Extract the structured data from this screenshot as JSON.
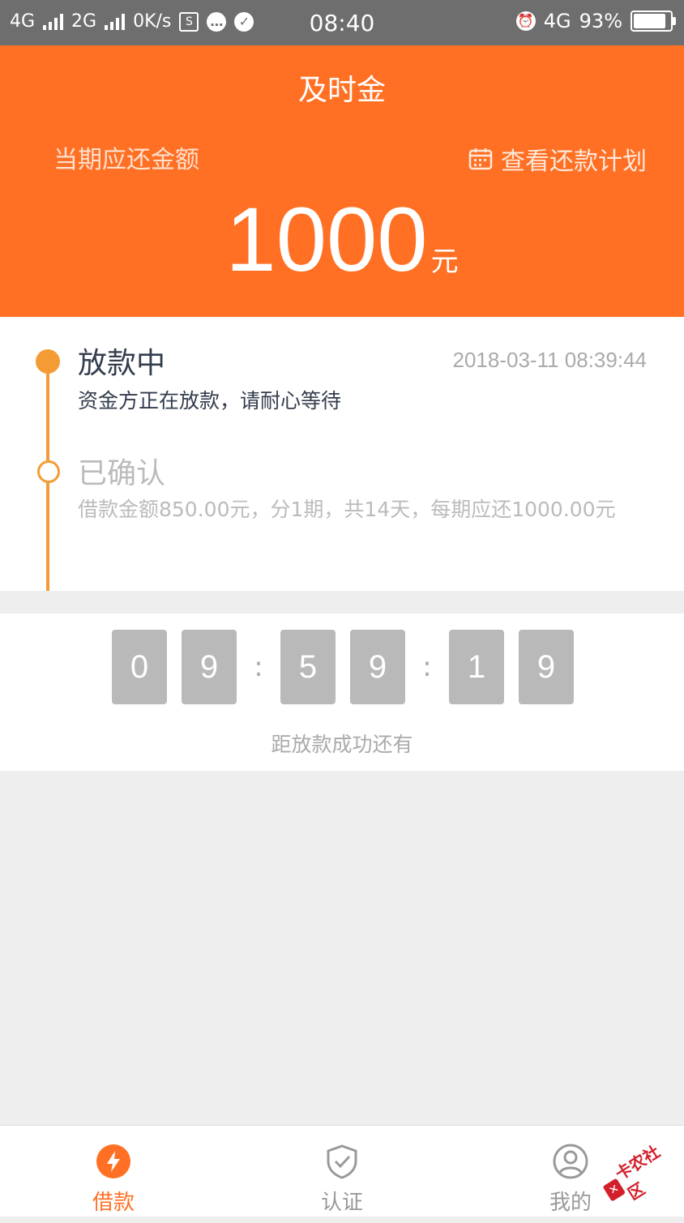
{
  "status_bar": {
    "network_1": "4G",
    "network_2": "2G",
    "speed": "0K/s",
    "time": "08:40",
    "net_right": "4G",
    "battery": "93%",
    "battery_level": 0.93
  },
  "header": {
    "title": "及时金",
    "period_label": "当期应还金额",
    "plan_link": "查看还款计划",
    "amount": "1000",
    "unit": "元",
    "bg_color": "#ff7024"
  },
  "timeline": {
    "steps": [
      {
        "title": "放款中",
        "time": "2018-03-11 08:39:44",
        "desc": "资金方正在放款，请耐心等待"
      },
      {
        "title": "已确认",
        "desc": "借款金额850.00元，分1期，共14天，每期应还1000.00元"
      }
    ],
    "accent_color": "#f59b35"
  },
  "countdown": {
    "digits": [
      "0",
      "9",
      "5",
      "9",
      "1",
      "9"
    ],
    "separator": ":",
    "caption": "距放款成功还有"
  },
  "tabbar": {
    "items": [
      {
        "label": "借款",
        "icon": "lightning-icon",
        "active": true
      },
      {
        "label": "认证",
        "icon": "shield-check-icon",
        "active": false
      },
      {
        "label": "我的",
        "icon": "user-icon",
        "active": false
      }
    ],
    "active_color": "#ff7024"
  },
  "watermark": {
    "text": "卡农社区"
  }
}
